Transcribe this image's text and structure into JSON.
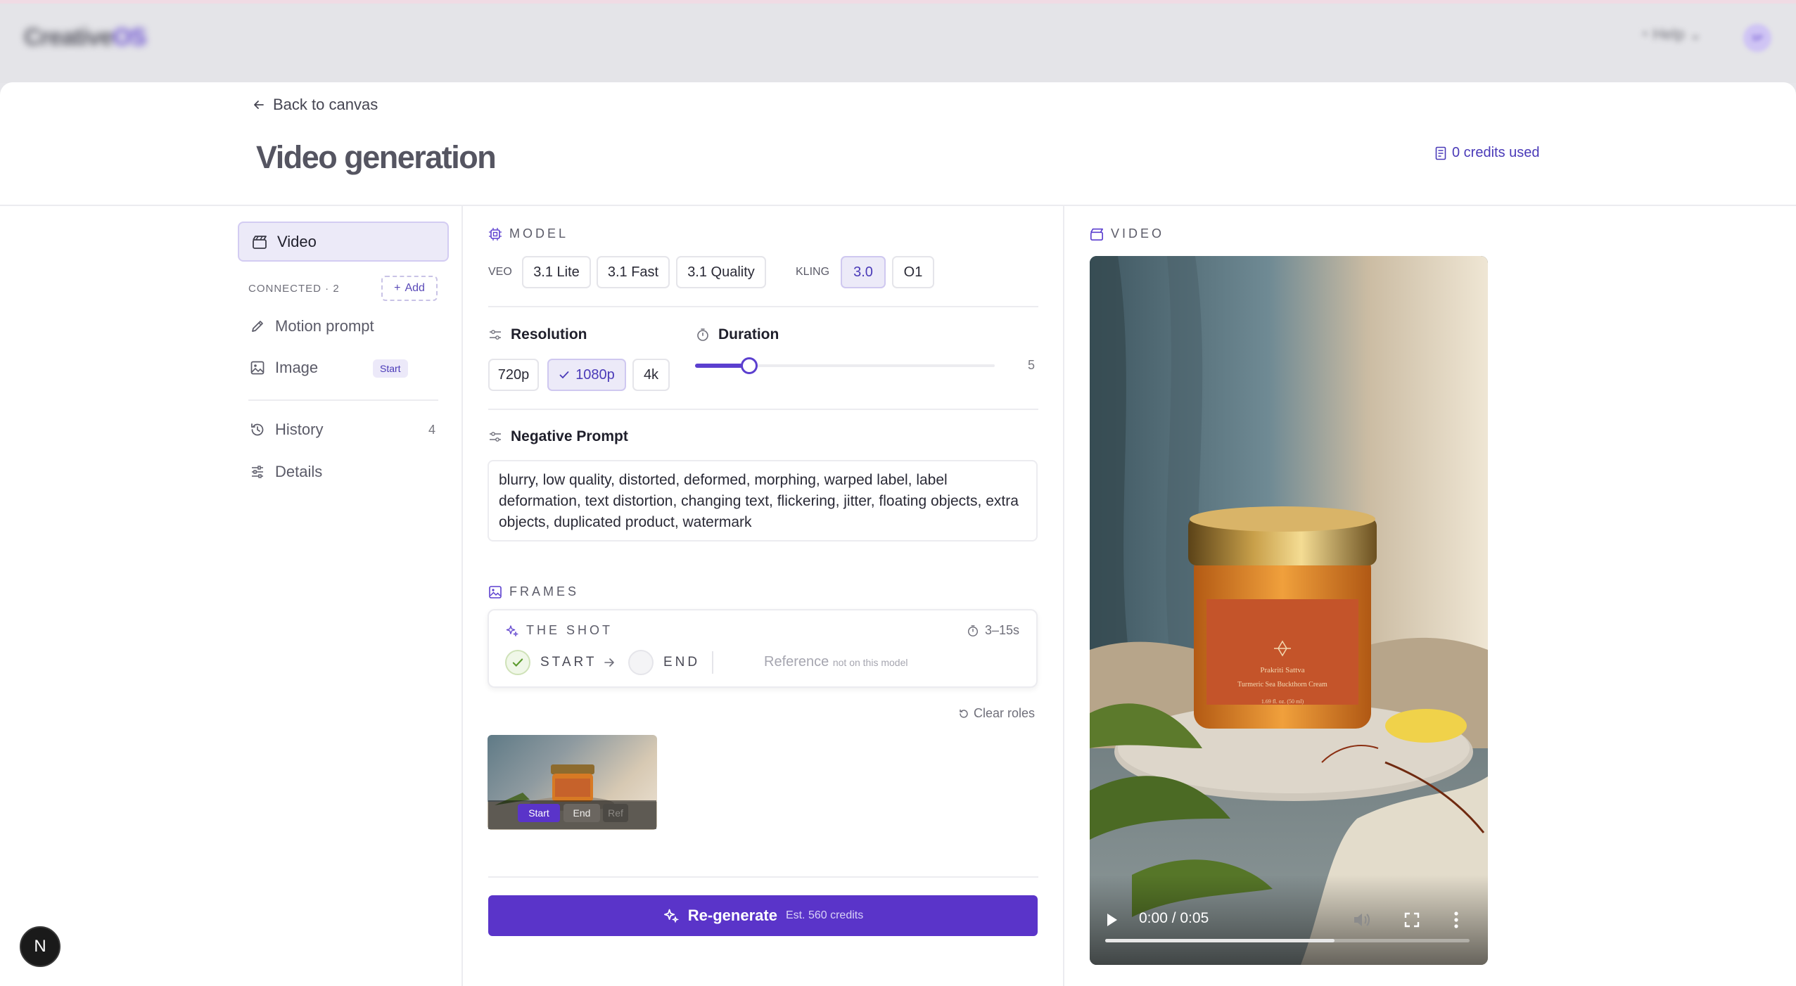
{
  "brand": {
    "name": "Creative",
    "suffix": "OS"
  },
  "topbar": {
    "help_label": "Help"
  },
  "user": {
    "initials": "SP"
  },
  "header": {
    "back_label": "Back to canvas",
    "title": "Video generation",
    "credits_label": "0 credits used"
  },
  "sidebar": {
    "active_item": "Video",
    "connected_label": "CONNECTED · 2",
    "add_label": "Add",
    "items": [
      {
        "label": "Motion prompt"
      },
      {
        "label": "Image",
        "badge": "Start"
      }
    ],
    "history": {
      "label": "History",
      "count": "4"
    },
    "details_label": "Details"
  },
  "model": {
    "section_label": "MODEL",
    "veo_label": "VEO",
    "veo_options": [
      "3.1 Lite",
      "3.1 Fast",
      "3.1 Quality"
    ],
    "kling_label": "KLING",
    "kling_options": [
      "3.0",
      "O1"
    ],
    "selected": "3.0"
  },
  "resolution": {
    "label": "Resolution",
    "options": [
      "720p",
      "1080p",
      "4k"
    ],
    "selected": "1080p"
  },
  "duration": {
    "label": "Duration",
    "value": "5",
    "fraction": 0.18
  },
  "negative_prompt": {
    "label": "Negative Prompt",
    "text": "blurry, low quality, distorted, deformed, morphing, warped label, label deformation, text distortion, changing text, flickering, jitter, floating objects, extra objects, duplicated product, watermark"
  },
  "frames": {
    "section_label": "FRAMES",
    "shot_title": "THE SHOT",
    "range": "3–15s",
    "start_label": "START",
    "end_label": "END",
    "reference_label": "Reference",
    "reference_note": "not on this model",
    "clear_label": "Clear roles",
    "thumb_tags": [
      "Start",
      "End",
      "Ref"
    ]
  },
  "regenerate": {
    "label": "Re-generate",
    "estimate": "Est. 560 credits"
  },
  "video": {
    "section_label": "VIDEO",
    "time": "0:00 / 0:05",
    "progress": 0.63,
    "product_brand": "Prakriti Sattva",
    "product_name": "Turmeric Sea Buckthorn Cream",
    "product_size": "1.69 fl. oz. (50 ml)"
  },
  "dev_badge": "N",
  "colors": {
    "accent": "#5a34c9",
    "accent_soft": "#eceaf8",
    "text": "#1f1f2b"
  }
}
